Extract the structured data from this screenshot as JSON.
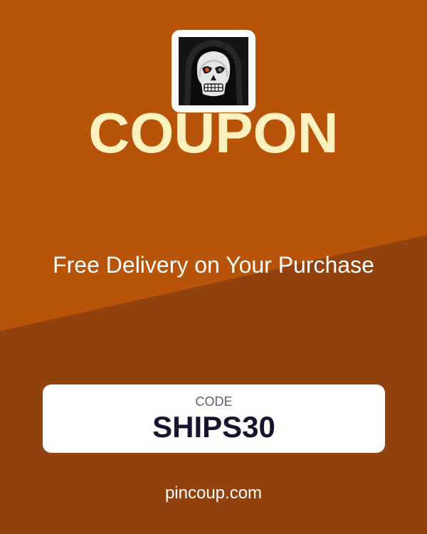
{
  "coupon": {
    "logo_icon": "grim-reaper-skull-icon",
    "title": "COUPON",
    "description": "Free Delivery on Your Purchase",
    "code_label": "CODE",
    "code": "SHIPS30",
    "website": "pincoup.com"
  },
  "colors": {
    "background_top": "#b7540a",
    "background_bottom": "#92420f",
    "title": "#fdf1c0",
    "code_box": "#ffffff",
    "code_text": "#17152e"
  }
}
